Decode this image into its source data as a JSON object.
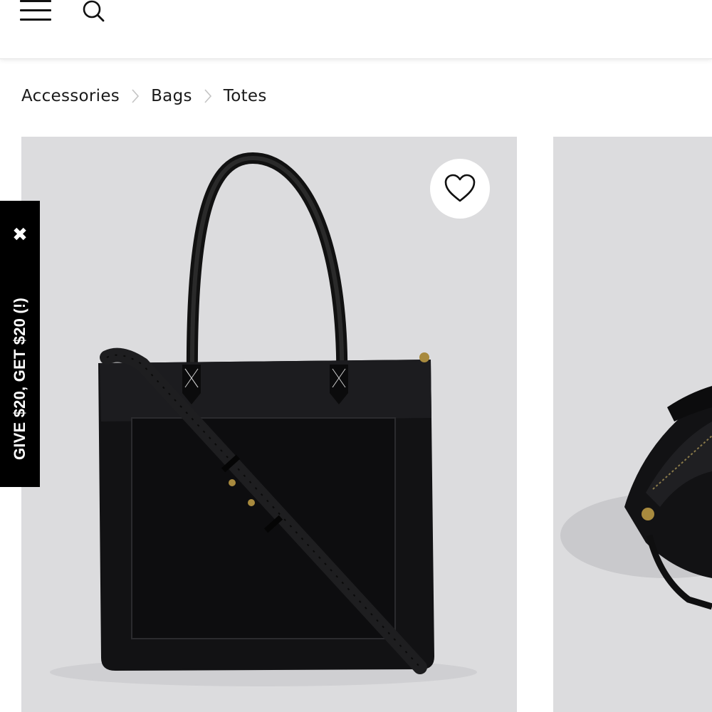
{
  "header": {
    "menu_icon": "hamburger-menu-icon",
    "search_icon": "search-icon"
  },
  "breadcrumb": {
    "items": [
      "Accessories",
      "Bags",
      "Totes"
    ],
    "separator_icon": "chevron-right-icon"
  },
  "product_gallery": {
    "main_image": "black-leather-tote-bag",
    "wishlist_icon": "heart-outline-icon",
    "secondary_image": "black-leather-tote-bag-angled"
  },
  "promo_tab": {
    "label": "GIVE $20, GET $20 (!)",
    "close_label": "✖"
  },
  "colors": {
    "background": "#ffffff",
    "image_background": "#dcdcde",
    "promo_background": "#000000",
    "text": "#1a1a1a"
  }
}
